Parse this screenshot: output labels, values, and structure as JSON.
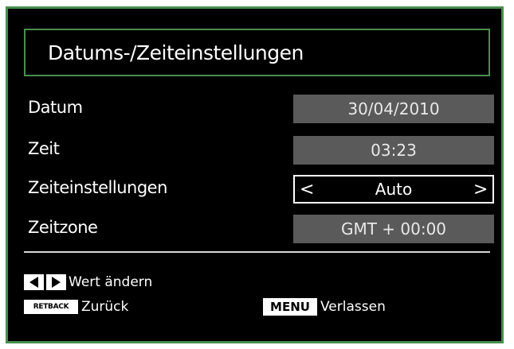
{
  "screen": {
    "title": "Datums-/Zeiteinstellungen"
  },
  "settings": {
    "rows": [
      {
        "label": "Datum",
        "value": "30/04/2010"
      },
      {
        "label": "Zeit",
        "value": "03:23"
      },
      {
        "label": "Zeiteinstellungen",
        "value": "Auto",
        "left_arrow": "<",
        "right_arrow": ">"
      },
      {
        "label": "Zeitzone",
        "value": "GMT + 00:00"
      }
    ]
  },
  "footer": {
    "change_value": "Wert ändern",
    "back_key": "RETBACK",
    "back": "Zurück",
    "menu_key": "MENU",
    "exit": "Verlassen"
  },
  "colors": {
    "frame": "#4a8e4f",
    "background": "#000000",
    "value_bg": "#5a5a5a"
  }
}
